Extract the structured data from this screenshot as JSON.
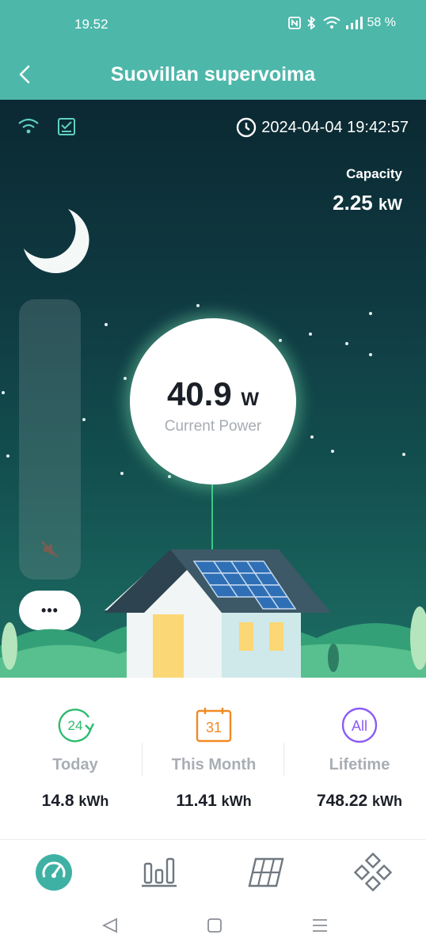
{
  "status_bar": {
    "time": "19.52",
    "battery": "58 %"
  },
  "header": {
    "title": "Suovillan supervoima"
  },
  "scene": {
    "datetime": "2024-04-04 19:42:57",
    "capacity_label": "Capacity",
    "capacity_value": "2.25",
    "capacity_unit": "kW",
    "current_power_value": "40.9",
    "current_power_unit": "W",
    "current_power_label": "Current Power",
    "more_button": "•••"
  },
  "stats": {
    "today": {
      "icon_text": "24",
      "label": "Today",
      "value": "14.8",
      "unit": "kWh"
    },
    "month": {
      "icon_text": "31",
      "label": "This Month",
      "value": "11.41",
      "unit": "kWh"
    },
    "lifetime": {
      "icon_text": "All",
      "label": "Lifetime",
      "value": "748.22",
      "unit": "kWh"
    }
  },
  "colors": {
    "brand": "#4db7aa",
    "today_accent": "#2dbb6e",
    "month_accent": "#f08a24",
    "lifetime_accent": "#8b5cf6",
    "power_stem": "#37c983"
  },
  "icons": {
    "status": [
      "nfc-icon",
      "bluetooth-icon",
      "wifi-icon",
      "signal-icon"
    ],
    "tabs": [
      "dashboard-gauge-icon",
      "bar-chart-icon",
      "solar-panel-icon",
      "devices-grid-icon"
    ],
    "nav": [
      "nav-back-icon",
      "nav-home-icon",
      "nav-menu-icon"
    ]
  }
}
